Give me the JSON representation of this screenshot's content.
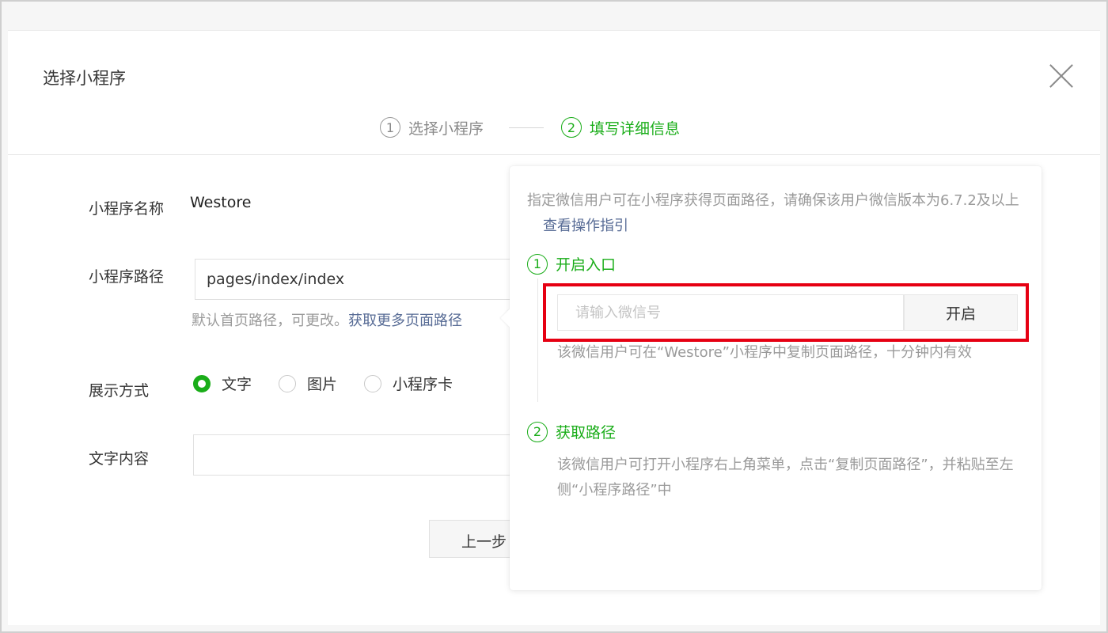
{
  "dialog": {
    "title": "选择小程序",
    "close_icon": "close-icon"
  },
  "steps": [
    {
      "num": "1",
      "label": "选择小程序",
      "state": "inactive"
    },
    {
      "num": "2",
      "label": "填写详细信息",
      "state": "active"
    }
  ],
  "form": {
    "name_label": "小程序名称",
    "name_value": "Westore",
    "path_label": "小程序路径",
    "path_value": "pages/index/index",
    "path_hint": "默认首页路径，可更改。",
    "path_hint_link": "获取更多页面路径",
    "display_label": "展示方式",
    "display_options": [
      {
        "label": "文字",
        "checked": true
      },
      {
        "label": "图片",
        "checked": false
      },
      {
        "label": "小程序卡",
        "checked": false
      }
    ],
    "text_label": "文字内容",
    "text_value": "",
    "prev_button": "上一步"
  },
  "popover": {
    "desc": "指定微信用户可在小程序获得页面路径，请确保该用户微信版本为6.7.2及以上",
    "desc_link": "查看操作指引",
    "step1_num": "1",
    "step1_title": "开启入口",
    "wechat_input_placeholder": "请输入微信号",
    "open_button": "开启",
    "step1_note": "该微信用户可在“Westore”小程序中复制页面路径，十分钟内有效",
    "step2_num": "2",
    "step2_title": "获取路径",
    "step2_note": "该微信用户可打开小程序右上角菜单，点击“复制页面路径”，并粘贴至左侧“小程序路径”中"
  },
  "colors": {
    "accent_green": "#1aad19",
    "link_blue": "#576b95",
    "highlight_red": "#e60012"
  }
}
